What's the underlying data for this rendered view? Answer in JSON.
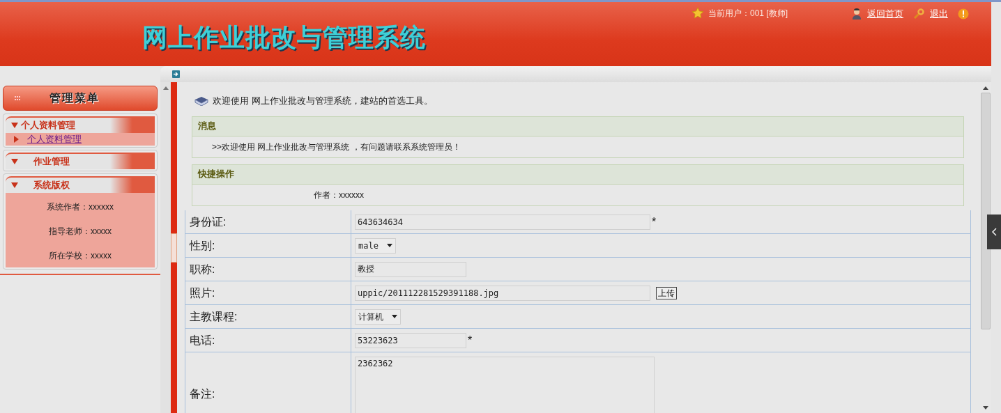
{
  "header": {
    "title": "网上作业批改与管理系统",
    "current_user": "当前用户：001 [教师]",
    "links": [
      {
        "label": "返回首页",
        "kind": "home"
      },
      {
        "label": "退出",
        "kind": "logout"
      }
    ]
  },
  "sidebar": {
    "title": "管理菜单",
    "sections": [
      {
        "title": "个人资料管理",
        "items": [
          {
            "label": "个人资料管理",
            "kind": "link"
          }
        ]
      },
      {
        "title": "作业管理"
      },
      {
        "title": "系统版权",
        "items": [
          {
            "label": "系统作者：xxxxxx",
            "kind": "text"
          },
          {
            "label": "指导老师：xxxxx",
            "kind": "text"
          },
          {
            "label": "所在学校：xxxxx",
            "kind": "text"
          }
        ]
      }
    ]
  },
  "welcome": "欢迎使用 网上作业批改与管理系统，建站的首选工具。",
  "panels": [
    {
      "title": "消息",
      "text": ">>欢迎使用 网上作业批改与管理系统 ，有问题请联系系统管理员！",
      "kind": "message"
    },
    {
      "title": "快捷操作",
      "text": "作者：xxxxxx",
      "kind": "shortcuts"
    }
  ],
  "form": {
    "rows": [
      {
        "label": "身份证:",
        "kind": "wide_text",
        "value": "643634634",
        "required_mark": "*"
      },
      {
        "label": "性别:",
        "kind": "select",
        "value": "male"
      },
      {
        "label": "职称:",
        "kind": "short_text",
        "value": "教授"
      },
      {
        "label": "照片:",
        "kind": "wide_text",
        "value": "uppic/201112281529391188.jpg",
        "button": "上传"
      },
      {
        "label": "主教课程:",
        "kind": "select",
        "value": "计算机"
      },
      {
        "label": "电话:",
        "kind": "short_text",
        "value": "53223623",
        "required_mark": "*"
      },
      {
        "label": "备注:",
        "kind": "textarea",
        "value": "2362362"
      }
    ]
  }
}
